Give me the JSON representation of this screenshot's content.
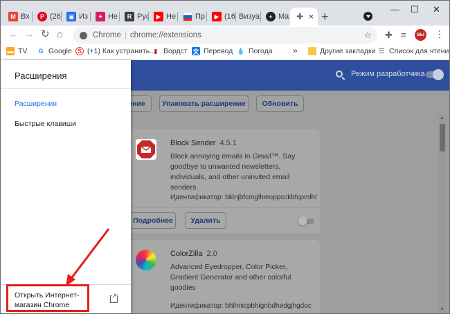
{
  "tabs": [
    {
      "label": "Вх",
      "icon": "gmail-icon",
      "color": "#ea4335"
    },
    {
      "label": "(26",
      "icon": "pinterest-icon",
      "color": "#e60023"
    },
    {
      "label": "Из",
      "icon": "page-icon",
      "color": "#1a73e8"
    },
    {
      "label": "Не",
      "icon": "puzzle-icon",
      "color": "#d81b60"
    },
    {
      "label": "Рус",
      "icon": "r-icon",
      "color": "#3c3c3c"
    },
    {
      "label": "Не",
      "icon": "youtube-icon",
      "color": "#ff0000"
    },
    {
      "label": "Пр",
      "icon": "flag-icon",
      "color": "#1565c0"
    },
    {
      "label": "(16",
      "icon": "youtube-icon",
      "color": "#ff0000"
    },
    {
      "label": "Визуал",
      "icon": "",
      "color": ""
    },
    {
      "label": "Ma",
      "icon": "circle-plus-icon",
      "color": "#202124"
    },
    {
      "label": "",
      "icon": "extension-icon",
      "color": "#5f6368",
      "active": true
    }
  ],
  "window_controls": {
    "minimize": "—",
    "maximize": "☐",
    "close": "✕"
  },
  "omnibox": {
    "chip": "Chrome",
    "url": "chrome://extensions"
  },
  "avatar_text": "ВЫ",
  "bookmarks": [
    {
      "label": "TV",
      "icon": "tv-icon",
      "color": "#f9a825"
    },
    {
      "label": "Google",
      "icon": "google-icon",
      "color": "#4285f4"
    },
    {
      "label": "(+1) Как устранить...",
      "icon": "s-icon",
      "color": "#e53935"
    },
    {
      "label": "Вордст",
      "icon": "chart-icon",
      "color": "#c62828"
    },
    {
      "label": "Перевод",
      "icon": "translate-icon",
      "color": "#1a73e8"
    },
    {
      "label": "Погода",
      "icon": "drop-icon",
      "color": "#1e88e5"
    }
  ],
  "bookmarks_more": "»",
  "other_bookmarks": "Другие закладки",
  "reading_list": "Список для чтения",
  "header": {
    "dev_mode": "Режим разработчика"
  },
  "actions": {
    "load_partial": "ение",
    "pack": "Упаковать расширение",
    "update": "Обновить"
  },
  "extensions": [
    {
      "name": "Block Sender",
      "version": "4.5.1",
      "description": "Block annoying emails in Gmail™. Say goodbye to unwanted newsletters, individuals, and other uninvited email senders.",
      "id_line": "Идентификатор: bklnjbfcmglhieoppcckbfcpmlhl",
      "details": "Подробнее",
      "remove": "Удалить"
    },
    {
      "name": "ColorZilla",
      "version": "2.0",
      "description": "Advanced Eyedropper, Color Picker, Gradient Generator and other colorful goodies",
      "id_line": "Идентификатор: bhlhnicpbhignbdhedgjhgdoc"
    }
  ],
  "drawer": {
    "title": "Расширения",
    "items": [
      "Расширения",
      "Быстрые клавиши"
    ],
    "store_line1": "Открыть Интернет-",
    "store_line2": "магазин Chrome"
  },
  "colors": {
    "accent": "#1a73e8",
    "header_blue": "#2f4f9e",
    "annotation_red": "#e51c1c"
  }
}
